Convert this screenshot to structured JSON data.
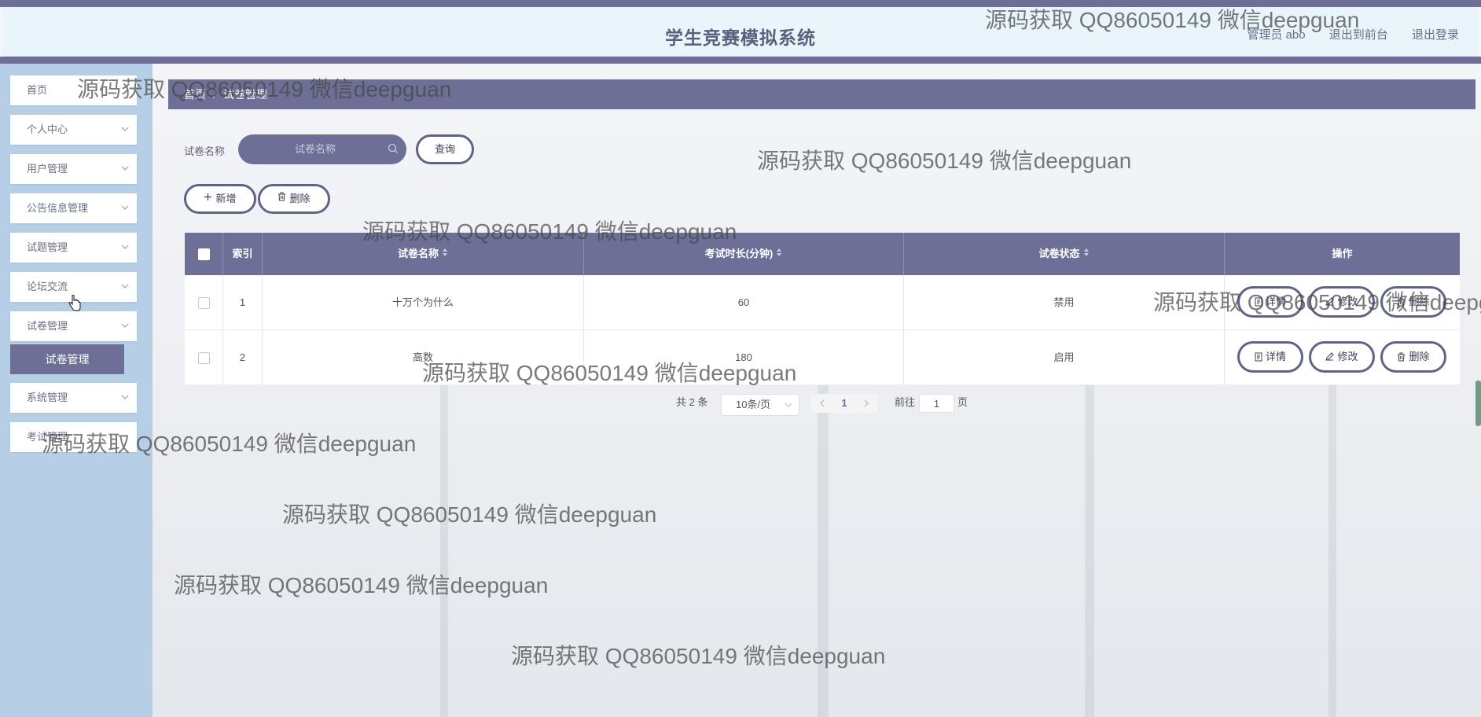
{
  "header": {
    "title": "学生竞赛模拟系统",
    "admin": "管理员 abo",
    "to_front": "退出到前台",
    "logout": "退出登录"
  },
  "sidebar": {
    "items": [
      {
        "label": "首页"
      },
      {
        "label": "个人中心"
      },
      {
        "label": "用户管理"
      },
      {
        "label": "公告信息管理"
      },
      {
        "label": "试题管理"
      },
      {
        "label": "论坛交流"
      },
      {
        "label": "试卷管理"
      },
      {
        "label": "系统管理"
      },
      {
        "label": "考试管理"
      }
    ],
    "active_sub": "试卷管理"
  },
  "breadcrumb": {
    "home": "首页",
    "separator": "/",
    "current": "试卷管理"
  },
  "search": {
    "label": "试卷名称",
    "placeholder": "试卷名称",
    "query_btn": "查询"
  },
  "actions": {
    "add": "新增",
    "delete": "删除"
  },
  "table": {
    "headers": {
      "index": "索引",
      "name": "试卷名称",
      "duration": "考试时长(分钟)",
      "status": "试卷状态",
      "ops": "操作"
    },
    "rows": [
      {
        "index": "1",
        "name": "十万个为什么",
        "duration": "60",
        "status": "禁用"
      },
      {
        "index": "2",
        "name": "高数",
        "duration": "180",
        "status": "启用"
      }
    ],
    "op_labels": {
      "detail": "详情",
      "edit": "修改",
      "delete": "删除"
    }
  },
  "pagination": {
    "total": "共 2 条",
    "page_size": "10条/页",
    "current_page": "1",
    "goto_label": "前往",
    "goto_value": "1",
    "page_unit": "页"
  },
  "watermark": "源码获取 QQ86050149 微信deepguan",
  "colors": {
    "primary": "#6e6f96",
    "sidebar": "#b6cfe7",
    "header": "#eaf4fb"
  }
}
